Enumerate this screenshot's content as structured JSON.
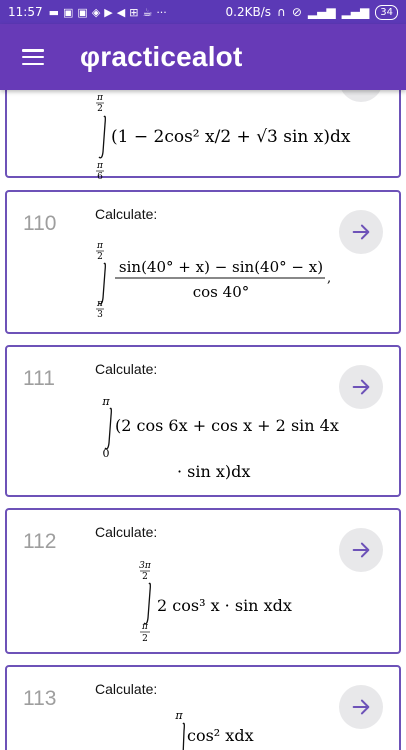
{
  "status_bar": {
    "time": "11:57",
    "notification_icons": [
      "chat-icon",
      "gallery-icon",
      "gallery-icon",
      "vpn-icon",
      "youtube-icon",
      "send-icon",
      "grid-icon",
      "cup-icon"
    ],
    "more": "···",
    "speed": "0.2KB/s",
    "battery": "34"
  },
  "app_bar": {
    "title": "φracticealot"
  },
  "accent_color": "#673ab7",
  "problems": [
    {
      "number": "",
      "prompt": "",
      "formula": {
        "upper_limit_num": "π",
        "upper_limit_den": "2",
        "lower_limit_num": "π",
        "lower_limit_den": "6",
        "body": "(1 − 2cos² x/2 + √3 sin x)dx"
      }
    },
    {
      "number": "110",
      "prompt": "Calculate:",
      "formula": {
        "upper_limit_num": "π",
        "upper_limit_den": "2",
        "lower_limit_num": "π",
        "lower_limit_den": "3",
        "numerator": "sin(40° + x) − sin(40° − x)",
        "denominator": "cos 40°",
        "trailing": ","
      }
    },
    {
      "number": "111",
      "prompt": "Calculate:",
      "formula": {
        "upper_limit": "π",
        "lower_limit": "0",
        "line1": "(2 cos 6x + cos x + 2 sin 4x",
        "line2": "· sin x)dx"
      }
    },
    {
      "number": "112",
      "prompt": "Calculate:",
      "formula": {
        "upper_limit_num": "3π",
        "upper_limit_den": "2",
        "lower_limit_num": "π",
        "lower_limit_den": "2",
        "body": "2 cos³ x · sin xdx"
      }
    },
    {
      "number": "113",
      "prompt": "Calculate:",
      "formula": {
        "upper_limit": "π",
        "body": "cos² xdx"
      }
    }
  ]
}
